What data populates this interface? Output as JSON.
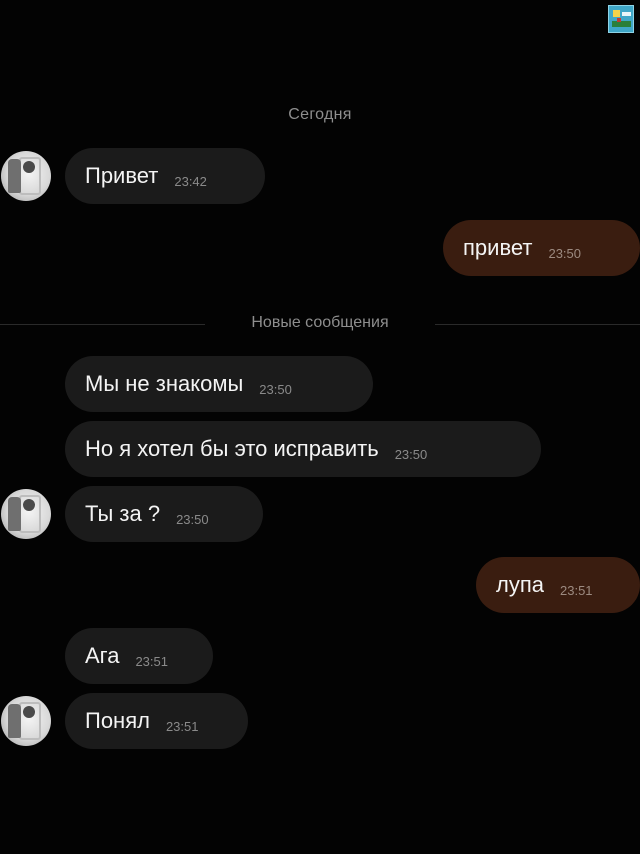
{
  "chat": {
    "date_separator": "Сегодня",
    "new_messages_separator": "Новые сообщения",
    "messages": [
      {
        "text": "Привет",
        "time": "23:42"
      },
      {
        "text": "привет",
        "time": "23:50"
      },
      {
        "text": "Мы не знакомы",
        "time": "23:50"
      },
      {
        "text": "Но я хотел бы это исправить",
        "time": "23:50"
      },
      {
        "text": "Ты за ?",
        "time": "23:50"
      },
      {
        "text": "лупа",
        "time": "23:51"
      },
      {
        "text": "Ага",
        "time": "23:51"
      },
      {
        "text": "Понял",
        "time": "23:51"
      }
    ]
  },
  "colors": {
    "background": "#030303",
    "incoming_bubble": "#1b1b1b",
    "outgoing_bubble": "#3a1d10",
    "secondary_text": "#8e8e8e"
  }
}
